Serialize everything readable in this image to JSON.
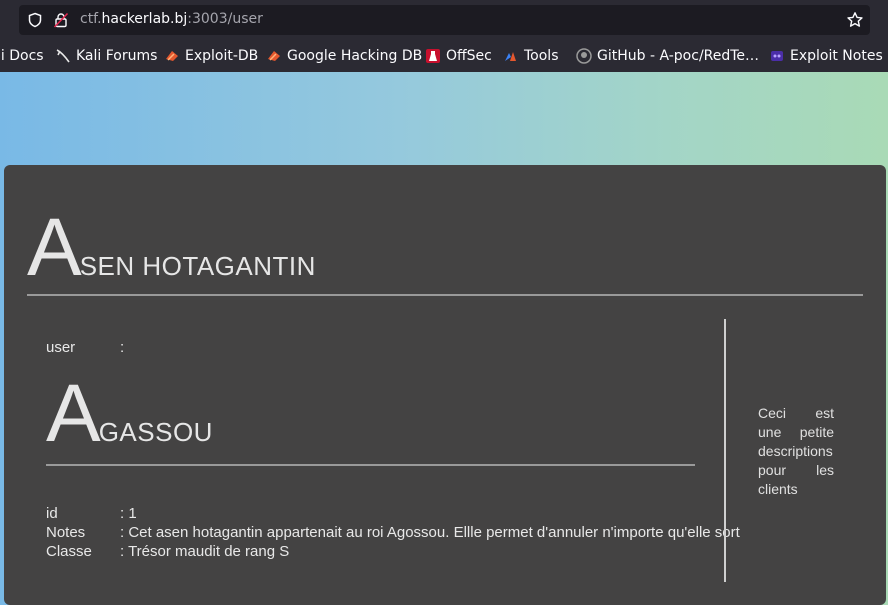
{
  "browser": {
    "url_host_prefix": "ctf.",
    "url_host_main": "hackerlab.bj",
    "url_rest": ":3003/user"
  },
  "bookmarks": [
    {
      "label": "li Docs",
      "icon": "none"
    },
    {
      "label": "Kali Forums",
      "icon": "kali-dragon-icon"
    },
    {
      "label": "Exploit-DB",
      "icon": "exploit-db-icon"
    },
    {
      "label": "Google Hacking DB",
      "icon": "exploit-db-icon"
    },
    {
      "label": "OffSec",
      "icon": "offsec-icon"
    },
    {
      "label": "Tools",
      "icon": "tools-icon"
    },
    {
      "label": "GitHub - A-poc/RedTe…",
      "icon": "github-icon"
    },
    {
      "label": "Exploit Notes",
      "icon": "exploit-notes-icon"
    }
  ],
  "card": {
    "title_initial": "A",
    "title_rest": "SEN HOTAGANTIN",
    "user_label": "user",
    "user_sep": ":",
    "user_initial": "A",
    "user_rest": "GASSOU",
    "fields": [
      {
        "label": "id",
        "value": ": 1"
      },
      {
        "label": "Notes",
        "value": ": Cet asen hotagantin appartenait au roi Agossou. Ellle permet d'annuler n'importe qu'elle sort"
      },
      {
        "label": "Classe",
        "value": ": Trésor maudit de rang S"
      }
    ],
    "description": "Ceci est une petite descriptions pour les clients"
  }
}
